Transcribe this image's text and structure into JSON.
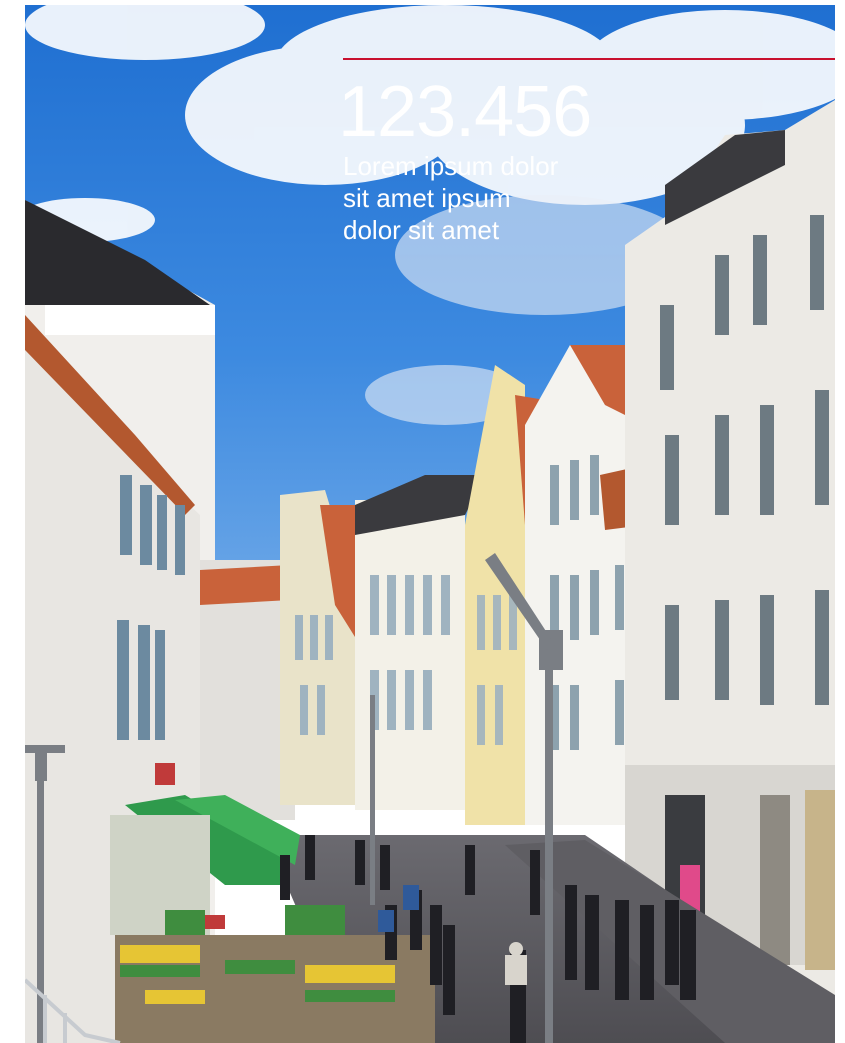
{
  "stat": {
    "number": "123.456",
    "caption_lines": [
      "Lorem ipsum dolor",
      "sit amet ipsum",
      "dolor sit amet"
    ]
  },
  "colors": {
    "accent_rule": "#c8102e",
    "text": "#ffffff",
    "sky": "#2f7fd6"
  },
  "photo": {
    "subject": "street-scene-image"
  }
}
